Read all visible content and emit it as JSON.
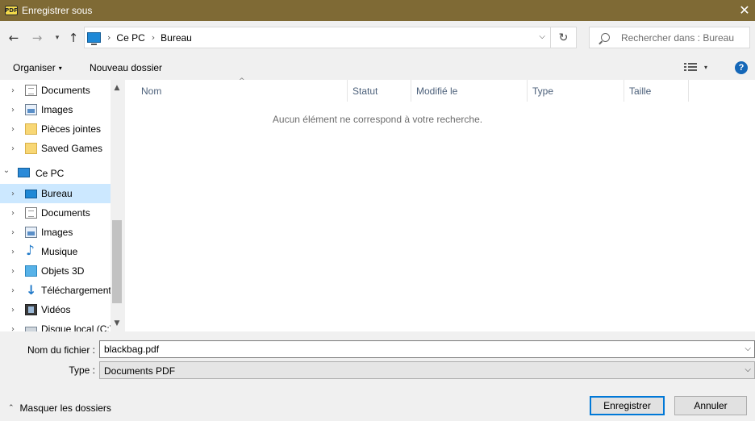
{
  "window": {
    "app_icon_text": "PDF",
    "title": "Enregistrer sous",
    "close_glyph": "✕"
  },
  "nav": {
    "back_glyph": "←",
    "forward_glyph": "→",
    "recent_glyph": "▾",
    "up_glyph": "↑"
  },
  "address": {
    "breadcrumb": [
      "Ce PC",
      "Bureau"
    ],
    "separator": "›",
    "dropdown_glyph": "⌵",
    "refresh_glyph": "↻"
  },
  "search": {
    "placeholder": "Rechercher dans : Bureau"
  },
  "toolbar": {
    "organiser": "Organiser",
    "caret": "▾",
    "new_folder": "Nouveau dossier",
    "help": "?"
  },
  "sidebar": {
    "chevron_right": "›",
    "chevron_down": "⌄",
    "items": [
      {
        "label": "Documents",
        "icon": "documents-icon"
      },
      {
        "label": "Images",
        "icon": "images-icon"
      },
      {
        "label": "Pièces jointes",
        "icon": "folder-icon"
      },
      {
        "label": "Saved Games",
        "icon": "folder-icon"
      },
      {
        "label": "Ce PC",
        "icon": "this-pc-icon"
      },
      {
        "label": "Bureau",
        "icon": "desktop-icon"
      },
      {
        "label": "Documents",
        "icon": "documents-icon"
      },
      {
        "label": "Images",
        "icon": "images-icon"
      },
      {
        "label": "Musique",
        "icon": "music-icon"
      },
      {
        "label": "Objets 3D",
        "icon": "objects-3d-icon"
      },
      {
        "label": "Téléchargements",
        "icon": "downloads-icon"
      },
      {
        "label": "Vidéos",
        "icon": "videos-icon"
      },
      {
        "label": "Disque local (C:)",
        "icon": "disk-icon"
      }
    ],
    "scroll_up": "▲",
    "scroll_down": "▼"
  },
  "list": {
    "sort_arrow": "^",
    "columns": [
      "Nom",
      "Statut",
      "Modifié le",
      "Type",
      "Taille"
    ],
    "empty_message": "Aucun élément ne correspond à votre recherche."
  },
  "form": {
    "filename_label": "Nom du fichier :",
    "filename_value": "blackbag.pdf",
    "type_label": "Type :",
    "type_value": "Documents PDF",
    "dropdown_glyph": "⌵"
  },
  "footer": {
    "hide_folders": "Masquer les dossiers",
    "caret_up": "⌃",
    "save": "Enregistrer",
    "cancel": "Annuler"
  }
}
